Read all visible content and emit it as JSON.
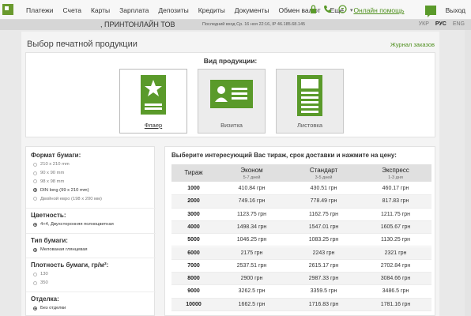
{
  "nav": {
    "items": [
      "Платежи",
      "Счета",
      "Карты",
      "Зарплата",
      "Депозиты",
      "Кредиты",
      "Документы",
      "Обмен валют",
      "Еще"
    ],
    "caret": "▾",
    "help": "Онлайн помощь",
    "exit": "Выход"
  },
  "company": {
    "name": ", ПРИНТОНЛАЙН ТОВ",
    "last_login": "Последний вход Ср. 16 ноя 22:16, IP 46.185.68.145"
  },
  "langs": [
    "УКР",
    "РУС",
    "ENG"
  ],
  "page": {
    "title": "Выбор печатной продукции",
    "journal": "Журнал заказов",
    "product_type_label": "Вид продукции:",
    "products": [
      "Флаер",
      "Визитка",
      "Листовка"
    ]
  },
  "filters": {
    "format": {
      "title": "Формат бумаги:",
      "options": [
        "210 х 210 mm",
        "90 х 90 mm",
        "98 х 98 mm",
        "DIN long (99 x 210 mm)",
        "Двойной евро (198 х 200 мм)"
      ],
      "selected": 3
    },
    "color": {
      "title": "Цветность:",
      "options": [
        "4+4, Двухсторонняя полноцветная"
      ]
    },
    "paper": {
      "title": "Тип бумаги:",
      "options": [
        "Мелованая глянцевая"
      ]
    },
    "density": {
      "title": "Плотность бумаги, гр/м²:",
      "options": [
        "130",
        "350"
      ]
    },
    "finish": {
      "title": "Отделка:",
      "options": [
        "Без отделки"
      ]
    }
  },
  "prices": {
    "prompt": "Выберите интересующий Вас тираж, срок доставки и нажмите на цену:",
    "headers": {
      "qty": "Тираж",
      "econom": "Эконом",
      "econom_sub": "5-7 дней",
      "standard": "Стандарт",
      "standard_sub": "3-5 дней",
      "express": "Экспресс",
      "express_sub": "1-3 дня"
    },
    "rows": [
      [
        "1000",
        "410.84 грн",
        "430.51 грн",
        "460.17 грн"
      ],
      [
        "2000",
        "749.16 грн",
        "778.49 грн",
        "817.83 грн"
      ],
      [
        "3000",
        "1123.75 грн",
        "1162.75 грн",
        "1211.75 грн"
      ],
      [
        "4000",
        "1498.34 грн",
        "1547.01 грн",
        "1605.67 грн"
      ],
      [
        "5000",
        "1046.25 грн",
        "1083.25 грн",
        "1130.25 грн"
      ],
      [
        "6000",
        "2175 грн",
        "2243 грн",
        "2321 грн"
      ],
      [
        "7000",
        "2537.51 грн",
        "2615.17 грн",
        "2702.84 грн"
      ],
      [
        "8000",
        "2900 грн",
        "2987.33 грн",
        "3084.66 грн"
      ],
      [
        "9000",
        "3262.5 грн",
        "3359.5 грн",
        "3486.5 грн"
      ],
      [
        "10000",
        "1662.5 грн",
        "1716.83 грн",
        "1781.16 грн"
      ]
    ]
  },
  "colors": {
    "accent": "#4e8f1d",
    "icon_green": "#5a9a2a"
  }
}
